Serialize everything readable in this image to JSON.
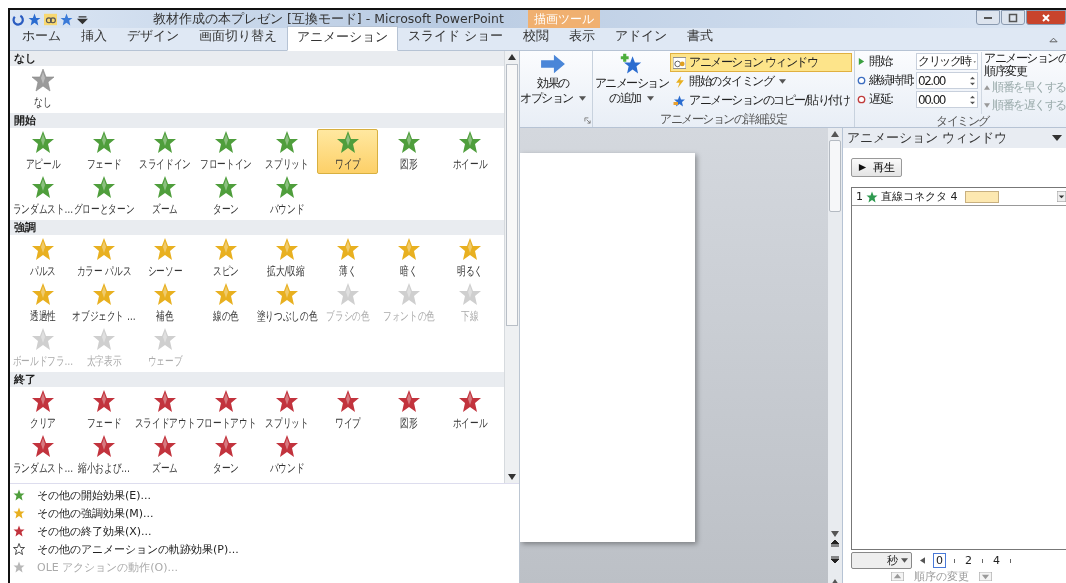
{
  "title_bar": {
    "title": "教材作成の本プレゼン [互換モード] - Microsoft PowerPoint",
    "context_tab": "描画ツール"
  },
  "tabs": [
    {
      "label": "ホーム",
      "selected": false
    },
    {
      "label": "挿入",
      "selected": false
    },
    {
      "label": "デザイン",
      "selected": false
    },
    {
      "label": "画面切り替え",
      "selected": false
    },
    {
      "label": "アニメーション",
      "selected": true
    },
    {
      "label": "スライド ショー",
      "selected": false
    },
    {
      "label": "校閲",
      "selected": false
    },
    {
      "label": "表示",
      "selected": false
    },
    {
      "label": "アドイン",
      "selected": false
    },
    {
      "label": "書式",
      "selected": false
    }
  ],
  "ribbon": {
    "effect_options": {
      "lines": [
        "効果の",
        "オプション"
      ]
    },
    "add_animation": {
      "lines": [
        "アニメーション",
        "の追加"
      ]
    },
    "advanced": {
      "group_label": "アニメーションの詳細設定",
      "buttons": [
        {
          "label": "アニメーション ウィンドウ",
          "selected": true,
          "dropdown": false
        },
        {
          "label": "開始のタイミング",
          "selected": false,
          "dropdown": true
        },
        {
          "label": "アニメーションのコピー/貼り付け",
          "selected": false,
          "dropdown": false
        }
      ]
    },
    "timing": {
      "group_label": "タイミング",
      "fields": [
        {
          "label": "開始:",
          "value": "クリック時",
          "kind": "dropdown"
        },
        {
          "label": "継続時間:",
          "value": "02.00",
          "kind": "spinner"
        },
        {
          "label": "遅延:",
          "value": "00.00",
          "kind": "spinner"
        }
      ],
      "reorder_title": "アニメーションの順序変更",
      "reorder": [
        {
          "label": "順番を早くする",
          "disabled": true
        },
        {
          "label": "順番を遅くする",
          "disabled": true
        }
      ]
    }
  },
  "gallery": {
    "sections": [
      {
        "title": "なし",
        "kind": "none",
        "items": [
          {
            "label": "なし",
            "selected": false,
            "disabled": false
          }
        ]
      },
      {
        "title": "開始",
        "kind": "entrance",
        "items": [
          {
            "label": "アピール",
            "selected": false,
            "disabled": false
          },
          {
            "label": "フェード",
            "selected": false,
            "disabled": false
          },
          {
            "label": "スライドイン",
            "selected": false,
            "disabled": false
          },
          {
            "label": "フロートイン",
            "selected": false,
            "disabled": false
          },
          {
            "label": "スプリット",
            "selected": false,
            "disabled": false
          },
          {
            "label": "ワイプ",
            "selected": true,
            "disabled": false
          },
          {
            "label": "図形",
            "selected": false,
            "disabled": false
          },
          {
            "label": "ホイール",
            "selected": false,
            "disabled": false
          },
          {
            "label": "ランダムスト…",
            "selected": false,
            "disabled": false
          },
          {
            "label": "グローとターン",
            "selected": false,
            "disabled": false
          },
          {
            "label": "ズーム",
            "selected": false,
            "disabled": false
          },
          {
            "label": "ターン",
            "selected": false,
            "disabled": false
          },
          {
            "label": "バウンド",
            "selected": false,
            "disabled": false
          }
        ]
      },
      {
        "title": "強調",
        "kind": "emphasis",
        "items": [
          {
            "label": "パルス",
            "selected": false,
            "disabled": false
          },
          {
            "label": "カラー パルス",
            "selected": false,
            "disabled": false
          },
          {
            "label": "シーソー",
            "selected": false,
            "disabled": false
          },
          {
            "label": "スピン",
            "selected": false,
            "disabled": false
          },
          {
            "label": "拡大/収縮",
            "selected": false,
            "disabled": false
          },
          {
            "label": "薄く",
            "selected": false,
            "disabled": false
          },
          {
            "label": "暗く",
            "selected": false,
            "disabled": false
          },
          {
            "label": "明るく",
            "selected": false,
            "disabled": false
          },
          {
            "label": "透過性",
            "selected": false,
            "disabled": false
          },
          {
            "label": "オブジェクト …",
            "selected": false,
            "disabled": false
          },
          {
            "label": "補色",
            "selected": false,
            "disabled": false
          },
          {
            "label": "線の色",
            "selected": false,
            "disabled": false
          },
          {
            "label": "塗りつぶしの色",
            "selected": false,
            "disabled": false
          },
          {
            "label": "ブラシの色",
            "selected": false,
            "disabled": true
          },
          {
            "label": "フォントの色",
            "selected": false,
            "disabled": true
          },
          {
            "label": "下線",
            "selected": false,
            "disabled": true
          },
          {
            "label": "ボールドフラ…",
            "selected": false,
            "disabled": true
          },
          {
            "label": "太字表示",
            "selected": false,
            "disabled": true
          },
          {
            "label": "ウェーブ",
            "selected": false,
            "disabled": true
          }
        ]
      },
      {
        "title": "終了",
        "kind": "exit",
        "items": [
          {
            "label": "クリア",
            "selected": false,
            "disabled": false
          },
          {
            "label": "フェード",
            "selected": false,
            "disabled": false
          },
          {
            "label": "スライドアウト",
            "selected": false,
            "disabled": false
          },
          {
            "label": "フロートアウト",
            "selected": false,
            "disabled": false
          },
          {
            "label": "スプリット",
            "selected": false,
            "disabled": false
          },
          {
            "label": "ワイプ",
            "selected": false,
            "disabled": false
          },
          {
            "label": "図形",
            "selected": false,
            "disabled": false
          },
          {
            "label": "ホイール",
            "selected": false,
            "disabled": false
          },
          {
            "label": "ランダムスト…",
            "selected": false,
            "disabled": false
          },
          {
            "label": "縮小および…",
            "selected": false,
            "disabled": false
          },
          {
            "label": "ズーム",
            "selected": false,
            "disabled": false
          },
          {
            "label": "ターン",
            "selected": false,
            "disabled": false
          },
          {
            "label": "バウンド",
            "selected": false,
            "disabled": false
          }
        ]
      }
    ],
    "menu": [
      {
        "label": "その他の開始効果(E)...",
        "kind": "entrance",
        "disabled": false
      },
      {
        "label": "その他の強調効果(M)...",
        "kind": "emphasis",
        "disabled": false
      },
      {
        "label": "その他の終了効果(X)...",
        "kind": "exit",
        "disabled": false
      },
      {
        "label": "その他のアニメーションの軌跡効果(P)...",
        "kind": "path",
        "disabled": false
      },
      {
        "label": "OLE アクションの動作(O)...",
        "kind": "ole",
        "disabled": true
      }
    ]
  },
  "animation_pane": {
    "title": "アニメーション ウィンドウ",
    "play_button": "再生",
    "items": [
      {
        "number": "1",
        "name": "直線コネクタ 4"
      }
    ],
    "timeline": {
      "unit": "秒",
      "ticks": [
        "0",
        "2",
        "4"
      ]
    },
    "reorder_label": "順序の変更"
  }
}
